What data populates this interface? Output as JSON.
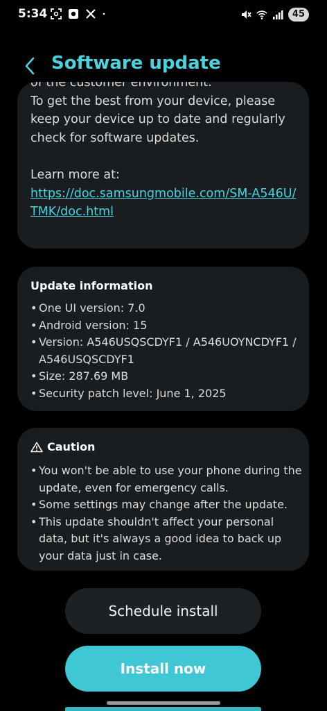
{
  "status_bar": {
    "time": "5:34",
    "battery": "45",
    "left_icons": [
      "screenshot-icon",
      "app-icon",
      "x-icon",
      "dot-icon"
    ],
    "right_icons": [
      "mute-icon",
      "wifi-icon",
      "signal-icon"
    ]
  },
  "header": {
    "title": "Software update",
    "back_icon": "chevron-left-icon"
  },
  "intro": {
    "partial_line": "of the customer environment.",
    "paragraph": "To get the best from your device, please keep your device up to date and regularly check for software updates.",
    "learn_more": "Learn more at:",
    "link": "https://doc.samsungmobile.com/SM-A546U/TMK/doc.html"
  },
  "update_info": {
    "title": "Update information",
    "items": [
      "One UI version: 7.0",
      "Android version: 15",
      "Version: A546USQSCDYF1 / A546UOYNCDYF1 / A546USQSCDYF1",
      "Size: 287.69 MB",
      "Security patch level: June 1, 2025"
    ]
  },
  "caution": {
    "title": "Caution",
    "icon": "warning-icon",
    "items": [
      "You won't be able to use your phone during the update, even for emergency calls.",
      "Some settings may change after the update.",
      "This update shouldn't affect your personal data, but it's always a good idea to back up your data just in case."
    ]
  },
  "buttons": {
    "schedule": "Schedule install",
    "install": "Install now"
  },
  "colors": {
    "accent": "#4ad3df",
    "button_primary": "#3fc7d3",
    "card_bg": "#1a1d20"
  }
}
